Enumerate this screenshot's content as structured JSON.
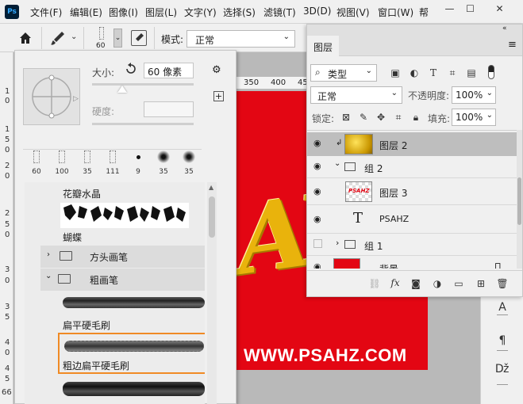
{
  "menubar": {
    "logo": "Ps",
    "items": [
      "文件(F)",
      "编辑(E)",
      "图像(I)",
      "图层(L)",
      "文字(Y)",
      "选择(S)",
      "滤镜(T)",
      "3D(D)",
      "视图(V)",
      "窗口(W)",
      "帮"
    ],
    "window_controls": [
      "—",
      "☐",
      "✕"
    ]
  },
  "options_bar": {
    "brush_size": "60",
    "mode_label": "模式:",
    "mode_value": "正常"
  },
  "ruler": {
    "top_marks": [
      "350",
      "400",
      "45"
    ],
    "left_marks": [
      "1",
      "0",
      "1",
      "5",
      "0",
      "2",
      "0",
      "2",
      "5",
      "0",
      "3",
      "0",
      "3",
      "5",
      "4",
      "0",
      "4",
      "5",
      "66"
    ]
  },
  "brush_panel": {
    "size_label": "大小:",
    "size_value": "60 像素",
    "hardness_label": "硬度:",
    "recent_brushes": [
      "60",
      "100",
      "35",
      "111",
      "9",
      "35",
      "35"
    ],
    "list": [
      {
        "type": "brush",
        "label": "花瓣水晶"
      },
      {
        "type": "brush",
        "label": "蝴蝶"
      },
      {
        "type": "folder",
        "label": "方头画笔",
        "expanded": false
      },
      {
        "type": "folder",
        "label": "粗画笔",
        "expanded": true
      },
      {
        "type": "brush",
        "label": "扁平硬毛刷"
      },
      {
        "type": "brush",
        "label": "粗边扁平硬毛刷",
        "selected": true
      }
    ]
  },
  "layers_panel": {
    "tab_title": "图层",
    "filter_label": "类型",
    "blend_mode": "正常",
    "opacity_label": "不透明度:",
    "opacity_value": "100%",
    "lock_label": "锁定:",
    "fill_label": "填充:",
    "fill_value": "100%",
    "layers": [
      {
        "name": "图层 2",
        "visible": true,
        "selected": true,
        "kind": "gold"
      },
      {
        "name": "组 2",
        "visible": true,
        "kind": "group",
        "expanded": true
      },
      {
        "name": "图层 3",
        "visible": true,
        "kind": "psahz-thumb",
        "thumb_text": "PSAHZ"
      },
      {
        "name": "PSAHZ",
        "visible": true,
        "kind": "text"
      },
      {
        "name": "组 1",
        "visible": false,
        "kind": "group",
        "expanded": false
      },
      {
        "name": "背景",
        "visible": true,
        "kind": "red",
        "locked": true
      }
    ]
  },
  "canvas": {
    "art_text": "AH",
    "watermark": "WWW.PSAHZ.COM",
    "doc_color": "#e30613",
    "gold_color": "#e9b30c"
  },
  "colors": {
    "selection_outline": "#f08a24",
    "selected_layer": "#bebebe"
  }
}
